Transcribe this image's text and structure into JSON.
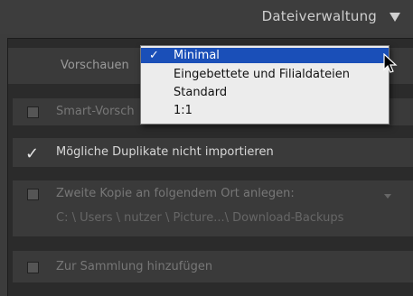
{
  "header": {
    "title": "Dateiverwaltung",
    "collapse_icon": "triangle-down-icon"
  },
  "vorschau": {
    "label": "Vorschauen"
  },
  "dropdown": {
    "options": [
      {
        "label": "Minimal",
        "selected": true,
        "check": "✓"
      },
      {
        "label": "Eingebettete und Filialdateien",
        "selected": false
      },
      {
        "label": "Standard",
        "selected": false
      },
      {
        "label": "1:1",
        "selected": false
      }
    ]
  },
  "rows": {
    "smart": {
      "label": "Smart-Vorsch",
      "checked": false
    },
    "duplikate": {
      "label": "Mögliche Duplikate nicht importieren",
      "checked": true,
      "check": "✓"
    },
    "zweite_kopie": {
      "label": "Zweite Kopie an folgendem Ort anlegen:",
      "checked": false,
      "path": "C: \\ Users \\ nutzer \\ Picture...\\ Download-Backups"
    },
    "sammlung": {
      "label": "Zur Sammlung hinzufügen",
      "checked": false
    }
  },
  "colors": {
    "selection": "#1a4fb8",
    "panel": "#2b2b2b",
    "row": "#3a3a3a"
  }
}
